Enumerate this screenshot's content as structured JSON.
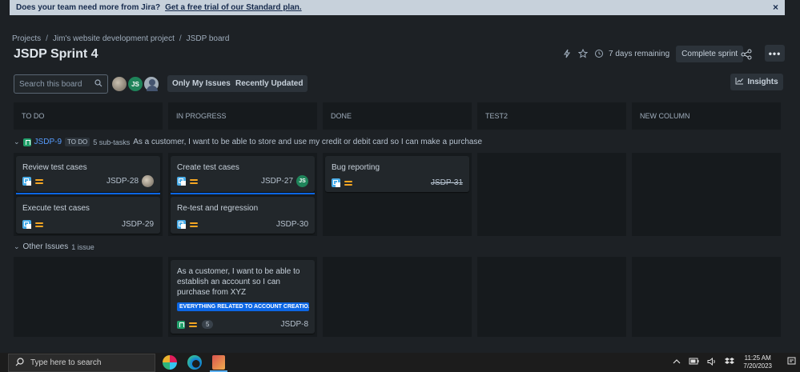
{
  "banner": {
    "question": "Does your team need more from Jira?",
    "link": "Get a free trial of our Standard plan.",
    "close": "×"
  },
  "breadcrumb": [
    "Projects",
    "Jim's website development project",
    "JSDP board"
  ],
  "breadcrumb_sep": "/",
  "page_title": "JSDP Sprint 4",
  "sprint": {
    "remaining": "7 days remaining",
    "complete_label": "Complete sprint",
    "more": "•••"
  },
  "search": {
    "placeholder": "Search this board"
  },
  "avatars": {
    "js": "JS"
  },
  "filters": {
    "only_mine": "Only My Issues",
    "recent": "Recently Updated"
  },
  "insights": "Insights",
  "columns": [
    "TO DO",
    "IN PROGRESS",
    "DONE",
    "TEST2",
    "NEW COLUMN"
  ],
  "swimlane_parent": {
    "key": "JSDP-9",
    "status": "TO DO",
    "subtasks": "5 sub-tasks",
    "summary": "As a customer, I want to be able to store and use my credit or debit card so I can make a purchase"
  },
  "swimlane_other": {
    "label": "Other Issues",
    "count": "1 issue"
  },
  "cards": {
    "c28": {
      "title": "Review test cases",
      "key": "JSDP-28"
    },
    "c29": {
      "title": "Execute test cases",
      "key": "JSDP-29"
    },
    "c27": {
      "title": "Create test cases",
      "key": "JSDP-27",
      "assignee": "JS"
    },
    "c30": {
      "title": "Re-test and regression",
      "key": "JSDP-30"
    },
    "c31": {
      "title": "Bug reporting",
      "key": "JSDP-31"
    },
    "c8": {
      "title": "As a customer, I want to be able to establish an account so I can purchase from XYZ",
      "epic": "EVERYTHING RELATED TO ACCOUNT CREATIO...",
      "points": "5",
      "key": "JSDP-8"
    }
  },
  "taskbar": {
    "search": "Type here to search",
    "time": "11:25 AM",
    "date": "7/20/2023"
  },
  "colors": {
    "background": "#1d2125",
    "column": "#161a1d",
    "card": "#22272b",
    "link": "#579dff",
    "epic": "#0c66e4"
  }
}
